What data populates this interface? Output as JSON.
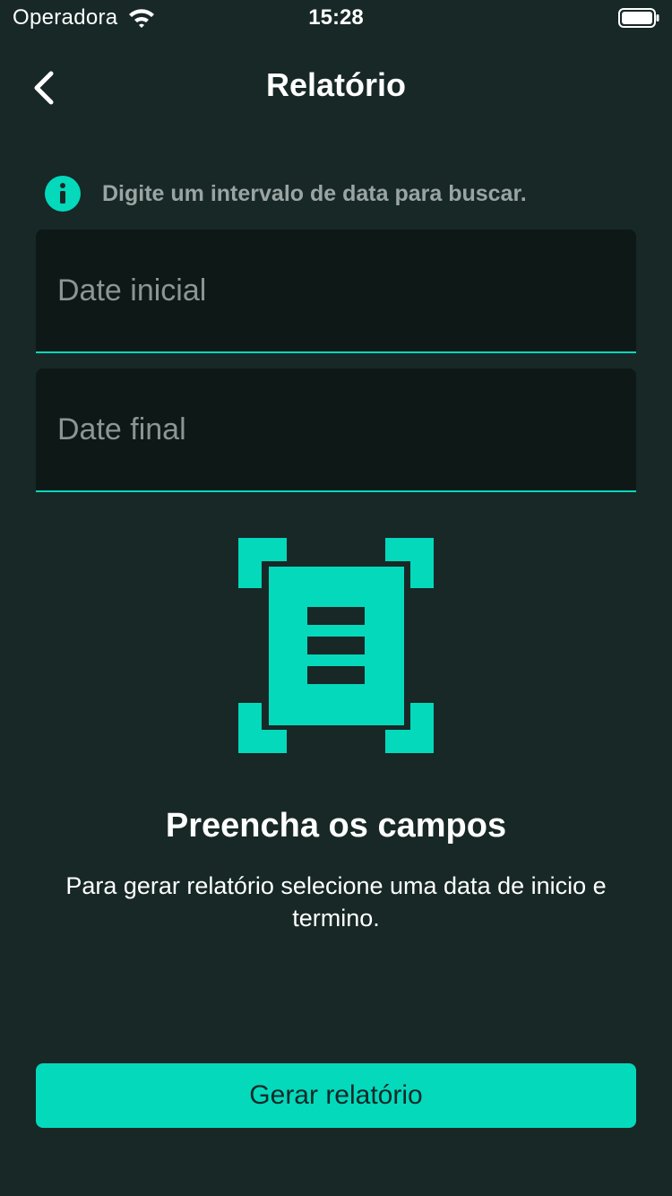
{
  "status_bar": {
    "carrier": "Operadora",
    "time": "15:28",
    "wifi_icon": "wifi-icon",
    "battery_icon": "battery-icon"
  },
  "header": {
    "back_icon": "chevron-left-icon",
    "title": "Relatório"
  },
  "info": {
    "icon": "info-icon",
    "text": "Digite um intervalo de data para buscar."
  },
  "form": {
    "start_date": {
      "placeholder": "Date inicial",
      "value": ""
    },
    "end_date": {
      "placeholder": "Date final",
      "value": ""
    }
  },
  "empty_state": {
    "icon": "document-scan-icon",
    "title": "Preencha os campos",
    "message": "Para gerar relatório selecione uma data de inicio e termino."
  },
  "actions": {
    "generate_label": "Gerar relatório"
  },
  "colors": {
    "background": "#172826",
    "field_background": "#0e1817",
    "accent": "#04d9bc",
    "muted_text": "#9aa5a3"
  }
}
